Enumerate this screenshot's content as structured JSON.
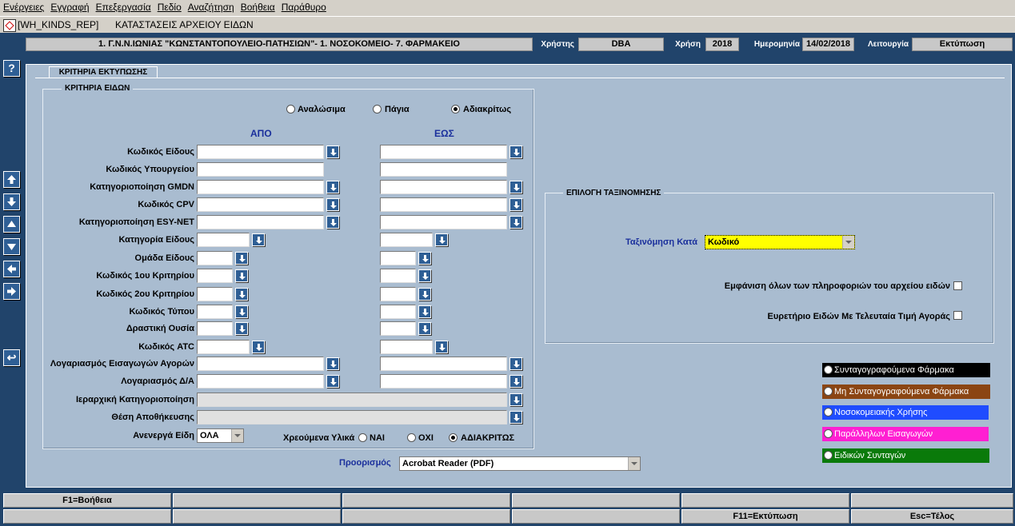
{
  "menu": [
    "Ενέργειες",
    "Εγγραφή",
    "Επεξεργασία",
    "Πεδίο",
    "Αναζήτηση",
    "Βοήθεια",
    "Παράθυρο"
  ],
  "window": {
    "form_id": "[WH_KINDS_REP]",
    "title": "ΚΑΤΑΣΤΑΣΕΙΣ ΑΡΧΕΙΟΥ ΕΙΔΩΝ"
  },
  "header": {
    "organization": "1. Γ.Ν.Ν.ΙΩΝΙΑΣ \"ΚΩΝΣΤΑΝΤΟΠΟΥΛΕΙΟ-ΠΑΤΗΣΙΩΝ\"- 1. ΝΟΣΟΚΟΜΕΙΟ- 7. ΦΑΡΜΑΚΕΙΟ",
    "user_label": "Χρήστης",
    "user": "DBA",
    "year_label": "Χρήση",
    "year": "2018",
    "date_label": "Ημερομηνία",
    "date": "14/02/2018",
    "mode_label": "Λειτουργία",
    "mode": "Εκτύπωση"
  },
  "nav": {
    "help": "?",
    "back": "↩"
  },
  "tab": {
    "label": "ΚΡΙΤΗΡΙΑ ΕΚΤΥΠΩΣΗΣ"
  },
  "criteria": {
    "title": "ΚΡΙΤΗΡΙΑ ΕΙΔΩΝ",
    "type_options": [
      "Αναλώσιμα",
      "Πάγια",
      "Αδιακρίτως"
    ],
    "selected_type": "Αδιακρίτως",
    "from": "ΑΠΟ",
    "to": "ΕΩΣ",
    "fields": [
      "Κωδικός Είδους",
      "Κωδικός Υπουργείου",
      "Κατηγοριοποίηση GMDN",
      "Κωδικός CPV",
      "Κατηγοριοποίηση ESY-NET",
      "Κατηγορία Είδους",
      "Ομάδα Είδους",
      "Κωδικός 1ου Κριτηρίου",
      "Κωδικός 2ου Κριτηρίου",
      "Κωδικός Τύπου",
      "Δραστική Ουσία",
      "Κωδικός ATC",
      "Λογαριασμός Εισαγωγών Αγορών",
      "Λογαριασμός Δ/Α",
      "Ιεραρχική Κατηγοριοποίηση",
      "Θέση Αποθήκευσης"
    ],
    "inactive_label": "Ανενεργά Είδη",
    "inactive_value": "ΟΛΑ",
    "charged_label": "Χρεούμενα Υλικά",
    "charged_options": [
      "ΝΑΙ",
      "ΟΧΙ",
      "ΑΔΙΑΚΡΙΤΩΣ"
    ],
    "charged_selected": "ΑΔΙΑΚΡΙΤΩΣ"
  },
  "sort": {
    "title": "ΕΠΙΛΟΓΗ ΤΑΞΙΝΟΜΗΣΗΣ",
    "label": "Ταξινόμηση Κατά",
    "value": "Κωδικό",
    "show_all_label": "Εμφάνιση όλων των πληροφοριών του αρχείου ειδών",
    "index_label": "Ευρετήριο Ειδών Με Τελευταία Τιμή Αγοράς"
  },
  "legend": [
    {
      "label": "Συνταγογραφούμενα Φάρμακα",
      "color": "#000000"
    },
    {
      "label": "Μη Συνταγογραφούμενα Φάρμακα",
      "color": "#8b4513"
    },
    {
      "label": "Νοσοκομειακής Χρήσης",
      "color": "#1f4cff"
    },
    {
      "label": "Παράλληλων Εισαγωγών",
      "color": "#ff1fd2"
    },
    {
      "label": "Ειδικών Συνταγών",
      "color": "#0a7a0a"
    }
  ],
  "destination": {
    "label": "Προορισμός",
    "value": "Acrobat Reader (PDF)"
  },
  "fkeys": {
    "row1": [
      "F1=Βοήθεια",
      "",
      "",
      "",
      "",
      ""
    ],
    "row2": [
      "",
      "",
      "",
      "",
      "F11=Εκτύπωση",
      "Esc=Τέλος"
    ]
  }
}
